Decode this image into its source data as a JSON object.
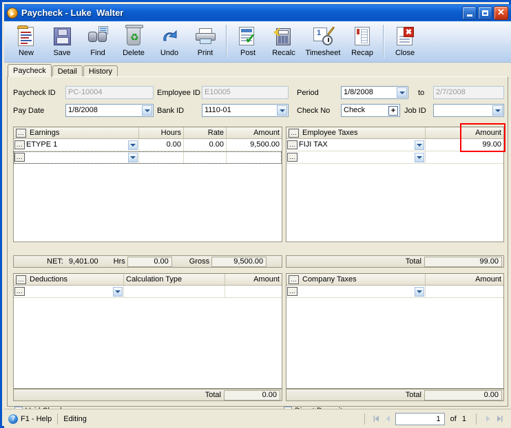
{
  "window": {
    "title": "Paycheck - Luke  Walter",
    "icon": "paycheck-app-icon",
    "minimize_label": "_",
    "maximize_label": "",
    "close_label": "✕"
  },
  "toolbar": {
    "buttons": [
      {
        "label": "New",
        "icon": "new-document-icon"
      },
      {
        "label": "Save",
        "icon": "floppy-disk-icon"
      },
      {
        "label": "Find",
        "icon": "binoculars-icon"
      },
      {
        "label": "Delete",
        "icon": "recycle-bin-icon"
      },
      {
        "label": "Undo",
        "icon": "undo-arrow-icon"
      },
      {
        "label": "Print",
        "icon": "printer-icon"
      },
      {
        "label": "Post",
        "icon": "post-checkmark-icon"
      },
      {
        "label": "Recalc",
        "icon": "calculator-icon"
      },
      {
        "label": "Timesheet",
        "icon": "clock-pencil-icon"
      },
      {
        "label": "Recap",
        "icon": "recap-report-icon"
      },
      {
        "label": "Close",
        "icon": "close-document-icon"
      }
    ]
  },
  "tabs": [
    {
      "label": "Paycheck",
      "active": true
    },
    {
      "label": "Detail",
      "active": false
    },
    {
      "label": "History",
      "active": false
    }
  ],
  "form": {
    "paycheck_id": {
      "label": "Paycheck ID",
      "value": "PC-10004",
      "readonly": true
    },
    "pay_date": {
      "label": "Pay Date",
      "value": "1/8/2008"
    },
    "employee_id": {
      "label": "Employee ID",
      "value": "E10005",
      "readonly": true
    },
    "bank_id": {
      "label": "Bank ID",
      "value": "1110-01"
    },
    "period": {
      "label": "Period",
      "value": "1/8/2008"
    },
    "period_to": {
      "label": "to",
      "value": "2/7/2008",
      "readonly": true
    },
    "check_no": {
      "label": "Check No",
      "value": "Check",
      "button": "+"
    },
    "job_id": {
      "label": "Job ID",
      "value": ""
    }
  },
  "earnings": {
    "title": "Earnings",
    "columns": [
      "Earnings",
      "Hours",
      "Rate",
      "Amount"
    ],
    "rows": [
      {
        "code": "ETYPE 1",
        "hours": "0.00",
        "rate": "0.00",
        "amount": "9,500.00"
      },
      {
        "code": "",
        "hours": "",
        "rate": "",
        "amount": ""
      }
    ],
    "footer": {
      "net_label": "NET:",
      "net_value": "9,401.00",
      "hrs_label": "Hrs",
      "hrs_value": "0.00",
      "gross_label": "Gross",
      "gross_value": "9,500.00"
    }
  },
  "employee_taxes": {
    "title": "Employee Taxes",
    "columns": [
      "Employee Taxes",
      "Amount"
    ],
    "rows": [
      {
        "code": "FIJI TAX",
        "amount": "99.00"
      },
      {
        "code": "",
        "amount": ""
      }
    ],
    "footer": {
      "total_label": "Total",
      "total_value": "99.00"
    },
    "highlight_color": "#ff0000"
  },
  "deductions": {
    "title": "Deductions",
    "columns": [
      "Deductions",
      "Calculation Type",
      "Amount"
    ],
    "rows": [
      {
        "code": "",
        "calc_type": "",
        "amount": ""
      }
    ],
    "footer": {
      "total_label": "Total",
      "total_value": "0.00"
    }
  },
  "company_taxes": {
    "title": "Company Taxes",
    "columns": [
      "Company Taxes",
      "Amount"
    ],
    "rows": [
      {
        "code": "",
        "amount": ""
      }
    ],
    "footer": {
      "total_label": "Total",
      "total_value": "0.00"
    }
  },
  "checkboxes": {
    "void_check": {
      "label": "Void Check",
      "checked": false
    },
    "direct_deposit": {
      "label": "Direct Deposit",
      "checked": false
    }
  },
  "statusbar": {
    "help": "F1 - Help",
    "mode": "Editing",
    "page_value": "1",
    "of_label": "of",
    "page_total": "1"
  },
  "grid_button_glyph": "..."
}
